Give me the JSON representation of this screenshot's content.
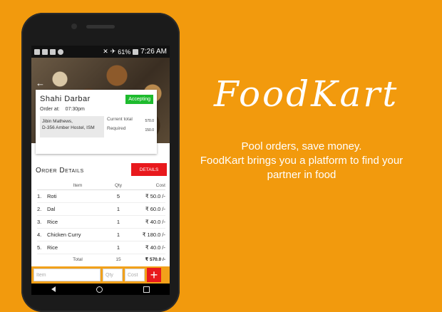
{
  "status_bar": {
    "time": "7:26 AM",
    "battery": "61%"
  },
  "restaurant": {
    "name": "Shahi Darbar",
    "status": "Accepting",
    "order_at_label": "Order at:",
    "order_at_time": "07:30pm",
    "address_line1": "Jibin Mathews,",
    "address_line2": "D-356 Amber Hostel, ISM",
    "current_total_label": "Current total",
    "current_total_value": "570.0",
    "required_label": "Required",
    "required_value": "150.0"
  },
  "order_details": {
    "title": "Order Details",
    "details_button": "DETAILS",
    "columns": {
      "item": "Item",
      "qty": "Qty",
      "cost": "Cost"
    },
    "rows": [
      {
        "no": "1.",
        "item": "Roti",
        "qty": "5",
        "cost": "₹ 50.0 /-"
      },
      {
        "no": "2.",
        "item": "Dal",
        "qty": "1",
        "cost": "₹ 60.0 /-"
      },
      {
        "no": "3.",
        "item": "Rice",
        "qty": "1",
        "cost": "₹ 40.0 /-"
      },
      {
        "no": "4.",
        "item": "Chicken Curry",
        "qty": "1",
        "cost": "₹ 180.0 /-"
      },
      {
        "no": "5.",
        "item": "Rice",
        "qty": "1",
        "cost": "₹ 40.0 /-"
      }
    ],
    "total": {
      "label": "Total",
      "qty": "15",
      "cost": "₹ 570.0 /-"
    }
  },
  "input_bar": {
    "item_placeholder": "Item",
    "qty_placeholder": "Qty",
    "cost_placeholder": "Cost",
    "add_label": "+"
  },
  "promo": {
    "brand": "FoodKart",
    "line1": "Pool orders, save money.",
    "line2": "FoodKart brings you a platform to find your",
    "line3": "partner in food"
  },
  "colors": {
    "background": "#f29a0d",
    "accent_red": "#e8191d",
    "status_green": "#1ebb2e"
  }
}
